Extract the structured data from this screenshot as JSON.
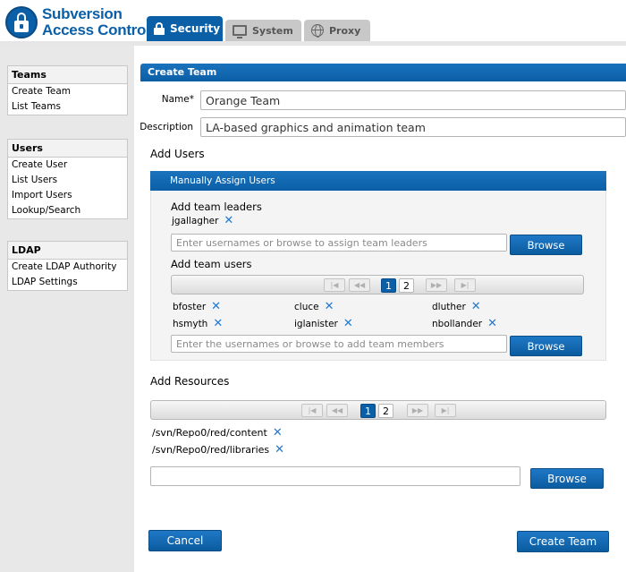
{
  "app": {
    "title_line1": "Subversion",
    "title_line2": "Access Control"
  },
  "tabs": [
    {
      "label": "Security",
      "icon": "lock-icon",
      "active": true
    },
    {
      "label": "System",
      "icon": "monitor-icon",
      "active": false
    },
    {
      "label": "Proxy",
      "icon": "globe-icon",
      "active": false
    }
  ],
  "sidebar": {
    "teams": {
      "title": "Teams",
      "items": [
        "Create Team",
        "List Teams"
      ]
    },
    "users": {
      "title": "Users",
      "items": [
        "Create User",
        "List Users",
        "Import Users",
        "Lookup/Search"
      ]
    },
    "ldap": {
      "title": "LDAP",
      "items": [
        "Create LDAP Authority",
        "LDAP Settings"
      ]
    }
  },
  "form": {
    "panel_title": "Create Team",
    "name_label": "Name*",
    "name_value": "Orange Team",
    "description_label": "Description",
    "description_value": "LA-based graphics and animation team",
    "add_users_title": "Add Users",
    "manual_assign_title": "Manually Assign Users",
    "team_leaders_label": "Add team leaders",
    "leaders": [
      "jgallagher"
    ],
    "leaders_placeholder": "Enter usernames or browse to assign team leaders",
    "team_users_label": "Add team users",
    "users_pager": {
      "pages": [
        "1",
        "2"
      ],
      "current": "1"
    },
    "users": [
      "bfoster",
      "cluce",
      "dluther",
      "hsmyth",
      "iglanister",
      "nbollander"
    ],
    "users_placeholder": "Enter the usernames or browse to add team members",
    "browse_label": "Browse",
    "add_resources_title": "Add Resources",
    "resources_pager": {
      "pages": [
        "1",
        "2"
      ],
      "current": "1"
    },
    "resources": [
      "/svn/Repo0/red/content",
      "/svn/Repo0/red/libraries"
    ],
    "resources_input_value": "",
    "cancel_label": "Cancel",
    "create_label": "Create Team"
  },
  "colors": {
    "accent": "#0b5fa6",
    "remove_icon": "#1f78d1",
    "sidebar_bg": "#e8e8e8"
  }
}
